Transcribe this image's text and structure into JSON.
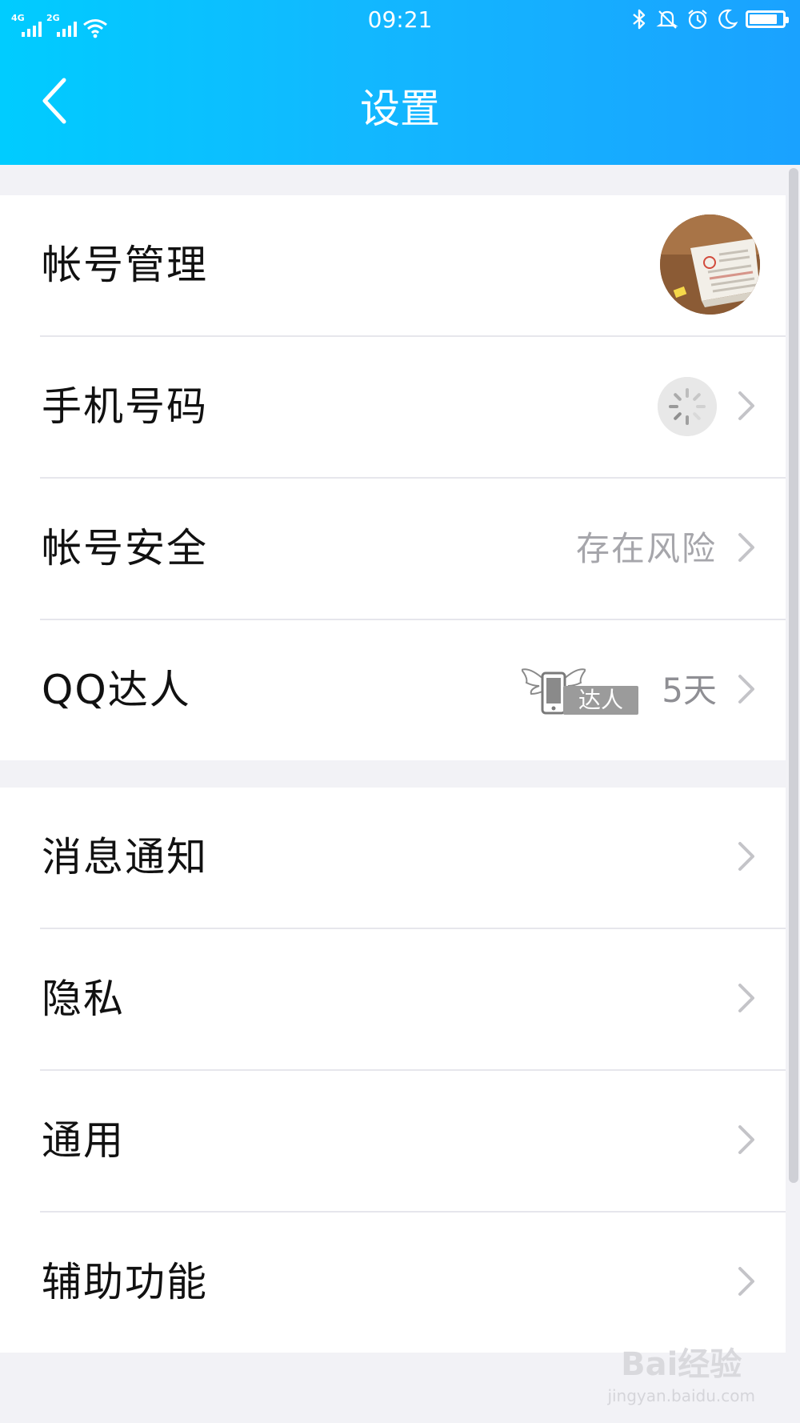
{
  "status_bar": {
    "sim1_label": "4G",
    "sim2_label": "2G",
    "time": "09:21",
    "icons": [
      "signal-4g-icon",
      "signal-2g-icon",
      "wifi-icon",
      "bluetooth-icon",
      "alarm-off-icon",
      "alarm-clock-icon",
      "moon-icon",
      "battery-icon"
    ]
  },
  "header": {
    "title": "设置",
    "back_icon": "chevron-left-icon",
    "gradient_start": "#00ccff",
    "gradient_end": "#1aa2ff"
  },
  "sections": [
    {
      "rows": [
        {
          "label": "帐号管理",
          "trailing": "avatar"
        },
        {
          "label": "手机号码",
          "trailing": "spinner"
        },
        {
          "label": "帐号安全",
          "value": "存在风险"
        },
        {
          "label": "QQ达人",
          "badge_text": "达人",
          "days": "5天"
        }
      ]
    },
    {
      "rows": [
        {
          "label": "消息通知"
        },
        {
          "label": "隐私"
        },
        {
          "label": "通用"
        },
        {
          "label": "辅助功能"
        }
      ]
    }
  ],
  "watermark": {
    "brand": "Bai经验",
    "url": "jingyan.baidu.com"
  },
  "colors": {
    "background": "#f2f2f6",
    "row_text": "#111111",
    "secondary_text": "#a6a6ab",
    "divider": "#e6e6ec"
  }
}
